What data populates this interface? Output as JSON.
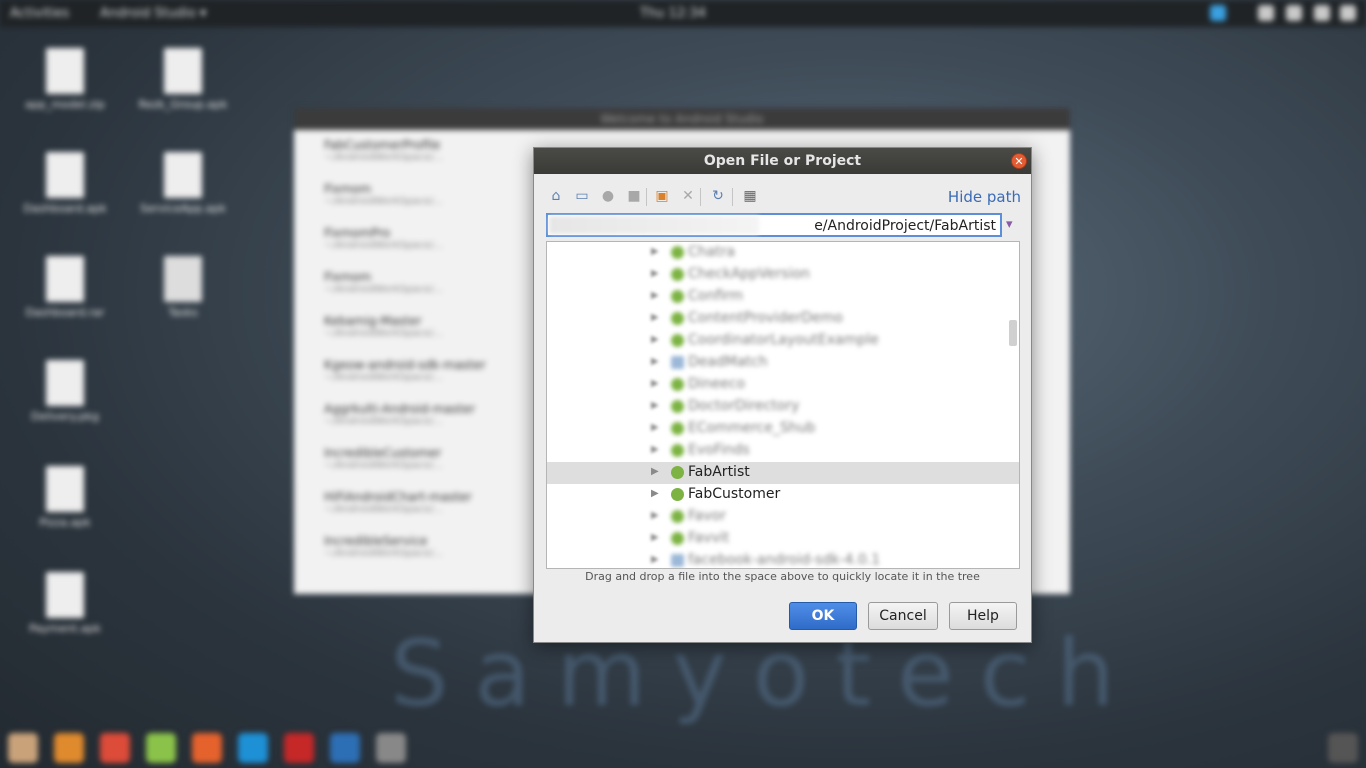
{
  "topbar": {
    "activities": "Activities",
    "app_menu": "Android Studio ▾",
    "clock": "Thu 12:34"
  },
  "desktop_icons": [
    "app_model.zip",
    "Rezk_Group.apk",
    "Dashboard.apk",
    "ServiceApp.apk",
    "Dashboard.rar",
    "Tasks",
    "Delivery.pkg",
    "Pizza.apk",
    "Payment.apk"
  ],
  "background_window": {
    "title": "Welcome to Android Studio",
    "projects": [
      {
        "name": "FabCustomerProfile",
        "path": "~/AndroidWorkSpace/..."
      },
      {
        "name": "Fixmom",
        "path": "~/AndroidWorkSpace/..."
      },
      {
        "name": "FixmomPro",
        "path": "~/AndroidWorkSpace/..."
      },
      {
        "name": "Fixmom",
        "path": "~/AndroidWorkSpace/..."
      },
      {
        "name": "Kebamig-Master",
        "path": "~/AndroidWorkSpace/..."
      },
      {
        "name": "Kgeow-android-sdk-master",
        "path": "~/AndroidWorkSpace/..."
      },
      {
        "name": "Aggrkulti-Android-master",
        "path": "~/AndroidWorkSpace/..."
      },
      {
        "name": "IncredibleCustomer",
        "path": "~/AndroidWorkSpace/..."
      },
      {
        "name": "HiFiAndroidChart-master",
        "path": "~/AndroidWorkSpace/..."
      },
      {
        "name": "IncredibleService",
        "path": "~/AndroidWorkSpace/..."
      }
    ]
  },
  "watermark": "Samyotech",
  "dialog": {
    "title": "Open File or Project",
    "hide_path": "Hide path",
    "path_value": "e/AndroidProject/FabArtist",
    "tree": [
      {
        "label": "Chatra",
        "blurred": true
      },
      {
        "label": "CheckAppVersion",
        "blurred": true
      },
      {
        "label": "Confirm",
        "blurred": true
      },
      {
        "label": "ContentProviderDemo",
        "blurred": true
      },
      {
        "label": "CoordinatorLayoutExample",
        "blurred": true
      },
      {
        "label": "DeadMatch",
        "blurred": true
      },
      {
        "label": "Dineeco",
        "blurred": true
      },
      {
        "label": "DoctorDirectory",
        "blurred": true
      },
      {
        "label": "ECommerce_Shub",
        "blurred": true
      },
      {
        "label": "EvoFinds",
        "blurred": true
      },
      {
        "label": "FabArtist",
        "blurred": false,
        "selected": true
      },
      {
        "label": "FabCustomer",
        "blurred": false
      },
      {
        "label": "Favor",
        "blurred": true
      },
      {
        "label": "Favvit",
        "blurred": true
      },
      {
        "label": "facebook-android-sdk-4.0.1",
        "blurred": true
      }
    ],
    "hint": "Drag and drop a file into the space above to quickly locate it in the tree",
    "ok": "OK",
    "cancel": "Cancel",
    "help": "Help"
  },
  "colors": {
    "accent": "#2f6cc9",
    "close": "#e25d33",
    "android_green": "#7cb342",
    "link": "#3b6bb5"
  }
}
